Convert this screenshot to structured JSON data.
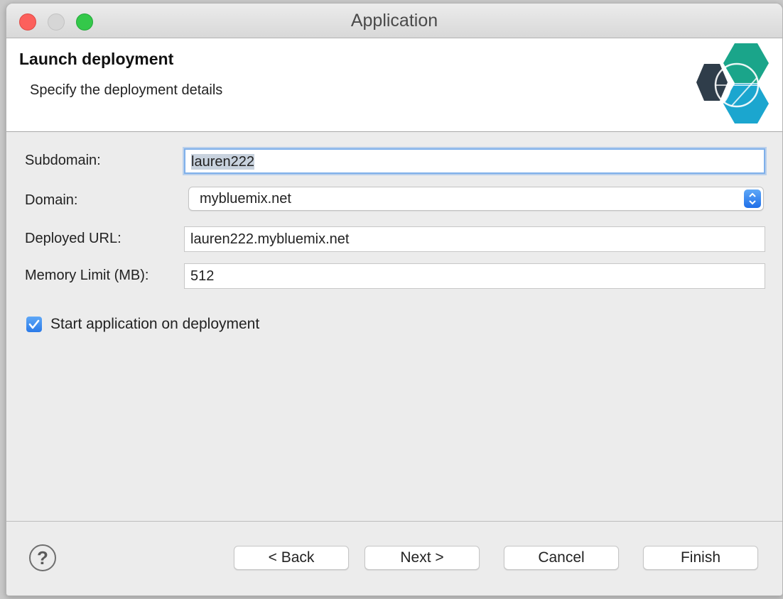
{
  "window": {
    "title": "Application"
  },
  "header": {
    "title": "Launch deployment",
    "subtitle": "Specify the deployment details"
  },
  "form": {
    "subdomain": {
      "label": "Subdomain:",
      "value": "lauren222"
    },
    "domain": {
      "label": "Domain:",
      "value": "mybluemix.net"
    },
    "deployed_url": {
      "label": "Deployed URL:",
      "value": "lauren222.mybluemix.net"
    },
    "memory_limit": {
      "label": "Memory Limit (MB):",
      "value": "512"
    },
    "start_on_deploy": {
      "label": "Start application on deployment",
      "checked": true
    }
  },
  "footer": {
    "help_glyph": "?",
    "back_label": "< Back",
    "next_label": "Next >",
    "cancel_label": "Cancel",
    "finish_label": "Finish"
  },
  "colors": {
    "accent": "#2a7ae8",
    "logo_teal": "#1aa58a",
    "logo_blue": "#1ba6cf",
    "logo_dark": "#2f3d4a"
  },
  "icons": {
    "logo": "bluemix-hexagon-logo",
    "help": "help-icon",
    "checkbox": "checkmark-icon",
    "select": "updown-chevron-icon"
  }
}
